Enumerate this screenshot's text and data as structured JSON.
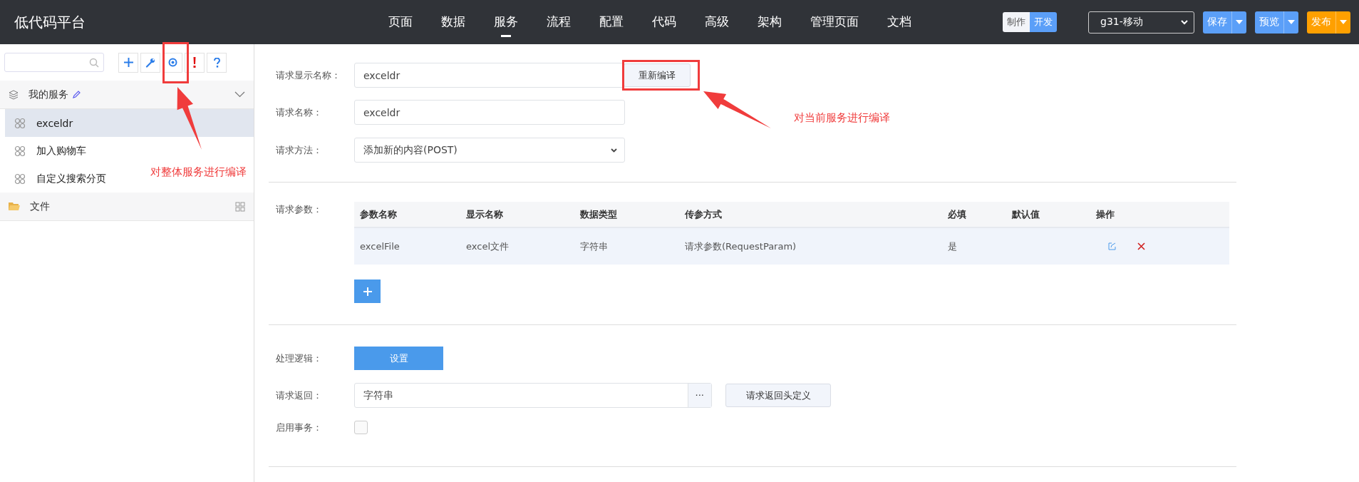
{
  "app": {
    "title": "低代码平台"
  },
  "nav": [
    {
      "label": "页面",
      "selected": false
    },
    {
      "label": "数据",
      "selected": false
    },
    {
      "label": "服务",
      "selected": true
    },
    {
      "label": "流程",
      "selected": false
    },
    {
      "label": "配置",
      "selected": false
    },
    {
      "label": "代码",
      "selected": false
    },
    {
      "label": "高级",
      "selected": false
    },
    {
      "label": "架构",
      "selected": false
    },
    {
      "label": "管理页面",
      "selected": false
    },
    {
      "label": "文档",
      "selected": false
    }
  ],
  "mode_toggle": [
    {
      "label": "制作",
      "selected": false
    },
    {
      "label": "开发",
      "selected": true
    }
  ],
  "project_select": {
    "value": "g31-移动"
  },
  "actions": [
    {
      "label": "保存",
      "color": "#5b9ff8"
    },
    {
      "label": "预览",
      "color": "#5b9ff8"
    },
    {
      "label": "发布",
      "color": "#ffa000"
    }
  ],
  "sidebar": {
    "sections": [
      {
        "title": "我的服务",
        "kind": "services",
        "items": [
          {
            "label": "exceldr",
            "selected": true
          },
          {
            "label": "加入购物车",
            "selected": false
          },
          {
            "label": "自定义搜索分页",
            "selected": false
          }
        ]
      },
      {
        "title": "文件",
        "kind": "files"
      }
    ]
  },
  "form": {
    "display_name": {
      "label": "请求显示名称：",
      "value": "exceldr",
      "button": "重新编译"
    },
    "name": {
      "label": "请求名称：",
      "value": "exceldr"
    },
    "method": {
      "label": "请求方法：",
      "value": "添加新的内容(POST)"
    },
    "params": {
      "label": "请求参数：",
      "columns": [
        "参数名称",
        "显示名称",
        "数据类型",
        "传参方式",
        "必填",
        "默认值",
        "操作"
      ],
      "rows": [
        {
          "name": "excelFile",
          "display": "excel文件",
          "type": "字符串",
          "mode": "请求参数(RequestParam)",
          "required": "是"
        }
      ]
    },
    "logic": {
      "label": "处理逻辑：",
      "button": "设置"
    },
    "return": {
      "label": "请求返回：",
      "value": "字符串",
      "more": "···",
      "button": "请求返回头定义"
    },
    "transaction": {
      "label": "启用事务：",
      "checked": false
    }
  },
  "annotations": [
    {
      "text": "对整体服务进行编译"
    },
    {
      "text": "对当前服务进行编译"
    }
  ]
}
